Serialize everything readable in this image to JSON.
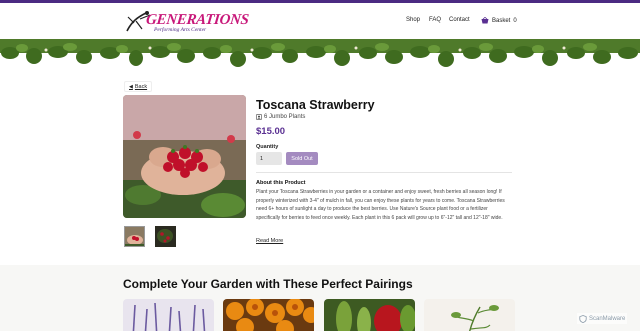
{
  "header": {
    "logo_main": "GENERATIONS",
    "logo_sub": "Performing Arts Center",
    "nav": {
      "shop": "Shop",
      "faq": "FAQ",
      "contact": "Contact",
      "basket": "Basket",
      "basket_count": "0"
    }
  },
  "product": {
    "back_label": "Back",
    "title": "Toscana Strawberry",
    "plants": "6 Jumbo Plants",
    "price": "$15.00",
    "quantity_label": "Quantity",
    "quantity_value": "1",
    "sold_out_label": "Sold Out",
    "about_heading": "About this Product",
    "about_text": "Plant your Toscana Strawberries in your garden or a container and enjoy sweet, fresh berries all season long! If properly winterized with 3-4\" of mulch in fall, you can enjoy these plants for years to come. Toscana Strawberries need 6+ hours of sunlight a day to produce the best berries. Use Nature's Source plant food or a fertilizer specifically for berries to feed once weekly. Each plant in this 6 pack will grow up to 6\"-12\" tall and 12\"-18\" wide.",
    "read_more": "Read More"
  },
  "pairings": {
    "title": "Complete Your Garden with These Perfect Pairings"
  },
  "badge": {
    "label": "ScanMalware"
  },
  "colors": {
    "accent": "#5a3092",
    "brand_pink": "#c8187a",
    "sold_out": "#a48bc0"
  }
}
